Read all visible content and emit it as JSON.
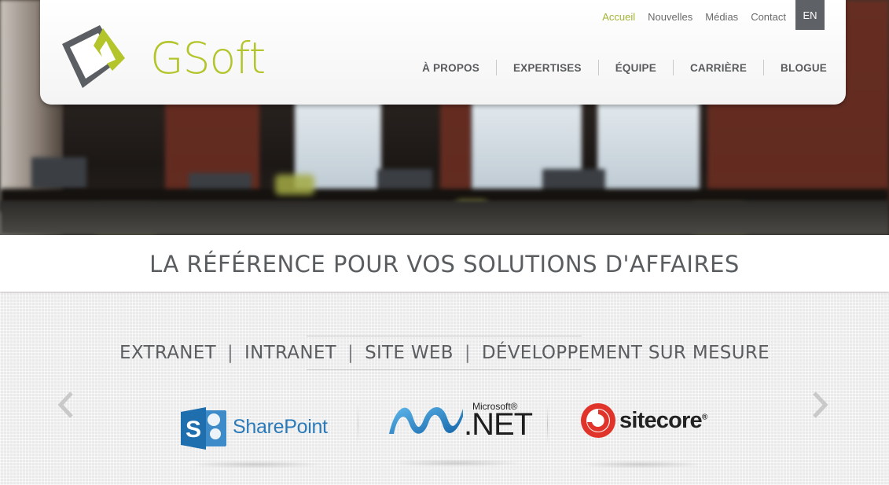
{
  "header": {
    "logo_text": "GSoft",
    "utility_links": [
      "Accueil",
      "Nouvelles",
      "Médias",
      "Contact"
    ],
    "active_utility": "Accueil",
    "lang_button": "EN",
    "main_nav": [
      "À PROPOS",
      "EXPERTISES",
      "ÉQUIPE",
      "CARRIÈRE",
      "BLOGUE"
    ]
  },
  "tagline": "LA RÉFÉRENCE POUR VOS SOLUTIONS D'AFFAIRES",
  "services": [
    "EXTRANET",
    "INTRANET",
    "SITE WEB",
    "DÉVELOPPEMENT SUR MESURE"
  ],
  "services_separator": "|",
  "carousel": {
    "brands": [
      {
        "name": "SharePoint",
        "icon": "sharepoint-logo-icon"
      },
      {
        "name": ".NET",
        "prefix": "Microsoft®",
        "icon": "dotnet-logo-icon"
      },
      {
        "name": "sitecore",
        "suffix": "®",
        "icon": "sitecore-logo-icon"
      }
    ],
    "prev_icon": "chevron-left-icon",
    "next_icon": "chevron-right-icon"
  },
  "colors": {
    "brand_green": "#b3c52b",
    "nav_text": "#585a5c",
    "lang_bg": "#5e6266",
    "sharepoint_blue": "#2a7ab9",
    "sitecore_red": "#e0342a"
  }
}
